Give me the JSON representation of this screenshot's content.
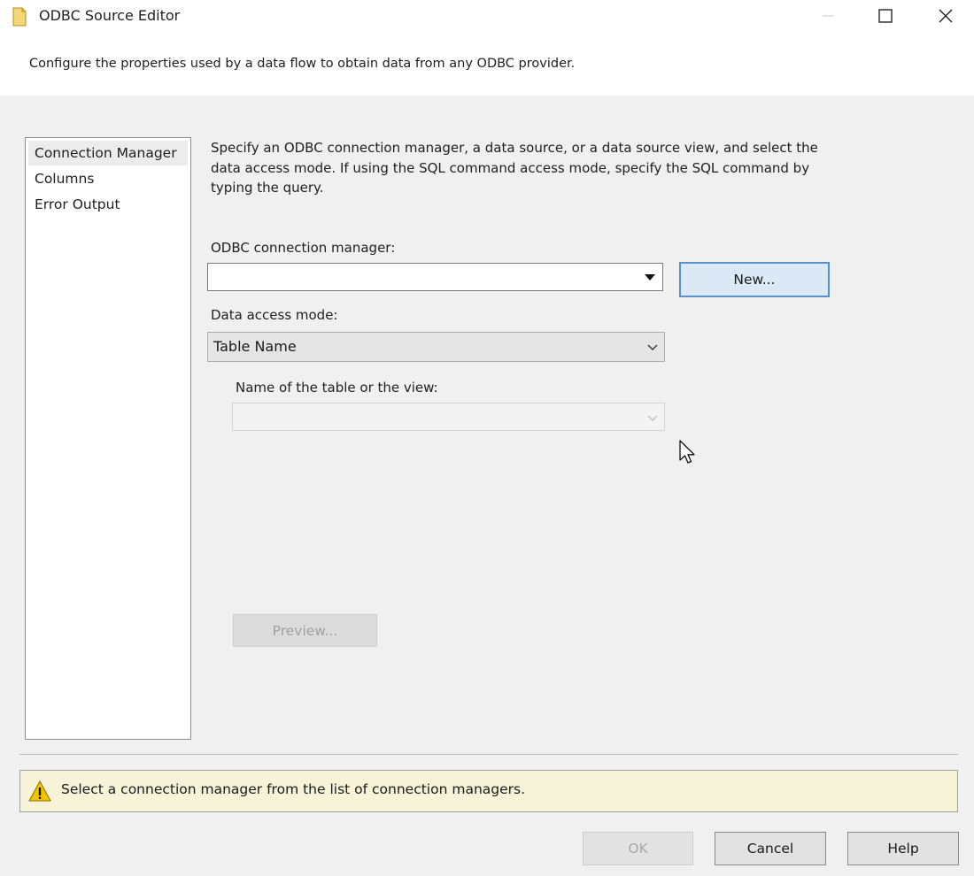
{
  "window": {
    "title": "ODBC Source Editor"
  },
  "header": {
    "description": "Configure the properties used by a data flow to obtain data from any ODBC provider."
  },
  "nav": {
    "items": [
      {
        "label": "Connection Manager",
        "selected": true
      },
      {
        "label": "Columns",
        "selected": false
      },
      {
        "label": "Error Output",
        "selected": false
      }
    ]
  },
  "main": {
    "intro": "Specify an ODBC connection manager, a data source, or a data source view, and select the data access mode. If using the SQL command access mode, specify the SQL command by typing the query.",
    "connection_label": "ODBC connection manager:",
    "connection_value": "",
    "new_button": "New...",
    "access_mode_label": "Data access mode:",
    "access_mode_value": "Table Name",
    "table_label": "Name of the table or the view:",
    "table_value": "",
    "preview_button": "Preview..."
  },
  "status": {
    "message": "Select a connection manager from the list of connection managers."
  },
  "footer": {
    "ok_label": "OK",
    "cancel_label": "Cancel",
    "help_label": "Help"
  },
  "colors": {
    "accent": "#5a90c8",
    "status_bg": "#f6f3d9",
    "warning": "#f2c400"
  }
}
